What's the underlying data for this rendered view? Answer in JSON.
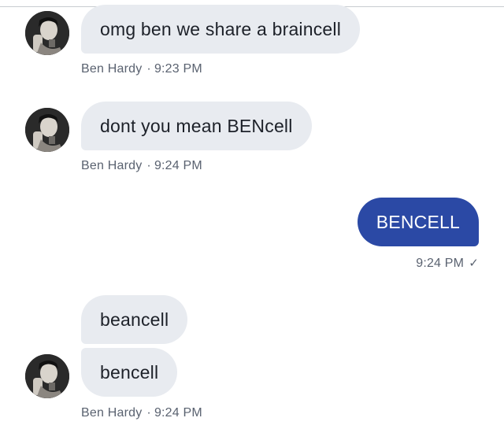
{
  "messages": [
    {
      "text": "omg ben we share a braincell",
      "sender": "Ben Hardy",
      "time": "9:23 PM"
    },
    {
      "text": "dont you mean BENcell",
      "sender": "Ben Hardy",
      "time": "9:24 PM"
    },
    {
      "text": "BENCELL",
      "time": "9:24 PM",
      "status": "✓"
    },
    {
      "text": "beancell"
    },
    {
      "text": "bencell",
      "sender": "Ben Hardy",
      "time": "9:24 PM"
    }
  ],
  "separator": "·",
  "colors": {
    "incoming_bubble": "#e8ebf0",
    "outgoing_bubble": "#2b49a5",
    "meta_text": "#5a6270"
  }
}
